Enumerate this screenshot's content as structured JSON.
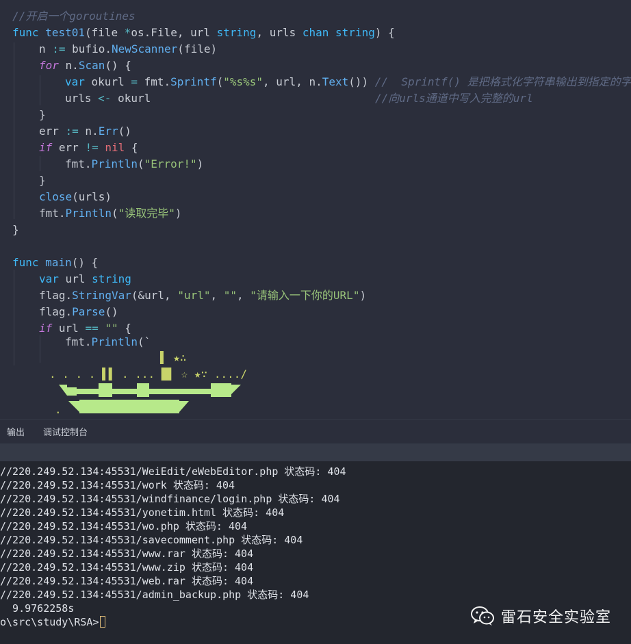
{
  "editor": {
    "code": {
      "comment_goroutines": "//开启一个goroutines",
      "kw_func": "func",
      "fn_test01": "test01",
      "p_open": "(file ",
      "op_star": "*",
      "p_osfile": "os.File, url ",
      "ty_string": "string",
      "p_comma_urls": ", urls ",
      "kw_chan": "chan",
      "p_sp": " ",
      "p_close_brace": ") {",
      "l3_a": "n ",
      "op_assign": ":=",
      "l3_b": " bufio.",
      "fn_newscanner": "NewScanner",
      "l3_c": "(file)",
      "kw_for": "for",
      "l4_a": " n.",
      "fn_scan": "Scan",
      "l4_b": "() {",
      "kw_var": "var",
      "l5_a": " okurl ",
      "op_eq": "=",
      "l5_b": " fmt.",
      "fn_sprintf": "Sprintf",
      "p_lparen": "(",
      "str_fmt": "\"%s%s\"",
      "l5_c": ", url, n.",
      "fn_text": "Text",
      "l5_d": "()) ",
      "comment_sprintf": "//  Sprintf() 是把格式化字符串输出到指定的字符串中",
      "l6_a": "urls ",
      "op_send": "<-",
      "l6_b": " okurl",
      "comment_urls": "//向urls通道中写入完整的url",
      "brace_close": "}",
      "l8_a": "err ",
      "l8_b": " n.",
      "fn_err": "Err",
      "l8_c": "()",
      "kw_if": "if",
      "l9_a": " err ",
      "op_ne": "!=",
      "p_space": " ",
      "bi_nil": "nil",
      "p_brace_open": " {",
      "l10_a": "fmt.",
      "fn_println": "Println",
      "str_error": "\"Error!\"",
      "p_rparen": ")",
      "fn_close": "close",
      "l12_a": "(urls)",
      "str_done": "\"读取完毕\"",
      "fn_main": "main",
      "l16_a": "() {",
      "l17_a": " url ",
      "l18_a": "flag.",
      "fn_stringvar": "StringVar",
      "l18_b": "(&url, ",
      "str_url": "\"url\"",
      "p_comma_sp": ", ",
      "str_empty": "\"\"",
      "str_hint": "\"请输入一下你的URL\"",
      "fn_parse": "Parse",
      "l19_a": "()",
      "l20_a": " url ",
      "op_eqeq": "==",
      "p_backtick": "(`"
    },
    "ascii_art": {
      "row1": "▌ ★∴",
      "row2": ". . . . ▌▌ . ... █▌  ☆ ★∵ ..../",
      "dot": "."
    }
  },
  "panel": {
    "tab_output": "输出",
    "tab_debug_console": "调试控制台"
  },
  "terminal": {
    "lines": [
      "//220.249.52.134:45531/WeiEdit/eWebEditor.php 状态码: 404",
      "//220.249.52.134:45531/work 状态码: 404",
      "//220.249.52.134:45531/windfinance/login.php 状态码: 404",
      "//220.249.52.134:45531/yonetim.html 状态码: 404",
      "//220.249.52.134:45531/wo.php 状态码: 404",
      "//220.249.52.134:45531/savecomment.php 状态码: 404",
      "//220.249.52.134:45531/www.rar 状态码: 404",
      "//220.249.52.134:45531/www.zip 状态码: 404",
      "//220.249.52.134:45531/web.rar 状态码: 404",
      "//220.249.52.134:45531/admin_backup.php 状态码: 404",
      "  9.9762258s"
    ],
    "prompt": "o\\src\\study\\RSA>"
  },
  "watermark": {
    "icon": "wechat-icon",
    "text": "雷石安全实验室"
  },
  "colors": {
    "editor_bg": "#2b2e3b",
    "terminal_bg": "#23262e",
    "keyword": "#3fb7f5",
    "function": "#61afef",
    "string": "#98c379",
    "comment": "#5f6a85",
    "ascii_art": "#c8d36a",
    "art_fill": "#b7e98a"
  }
}
